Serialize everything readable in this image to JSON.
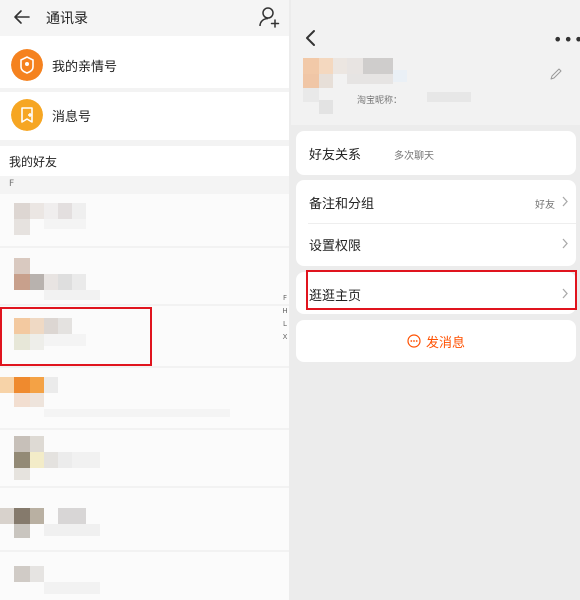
{
  "left": {
    "title": "通讯录",
    "entries": [
      {
        "label": "我的亲情号",
        "icon": "family-number-icon"
      },
      {
        "label": "消息号",
        "icon": "message-account-icon"
      }
    ],
    "friends_header": "我的好友",
    "section_letter": "F",
    "index_letters": [
      "F",
      "H",
      "L",
      "X"
    ]
  },
  "right": {
    "nickname_label": "淘宝昵称：",
    "sections": [
      {
        "label": "好友关系",
        "value": "多次聊天"
      },
      {
        "label": "备注和分组",
        "value": "好友"
      },
      {
        "label": "设置权限",
        "value": ""
      },
      {
        "label": "逛逛主页",
        "value": ""
      }
    ],
    "send_message": "发消息"
  },
  "colors": {
    "accent": "#ff5000",
    "highlight": "#e0141e",
    "icon_orange": "#f5821f"
  }
}
